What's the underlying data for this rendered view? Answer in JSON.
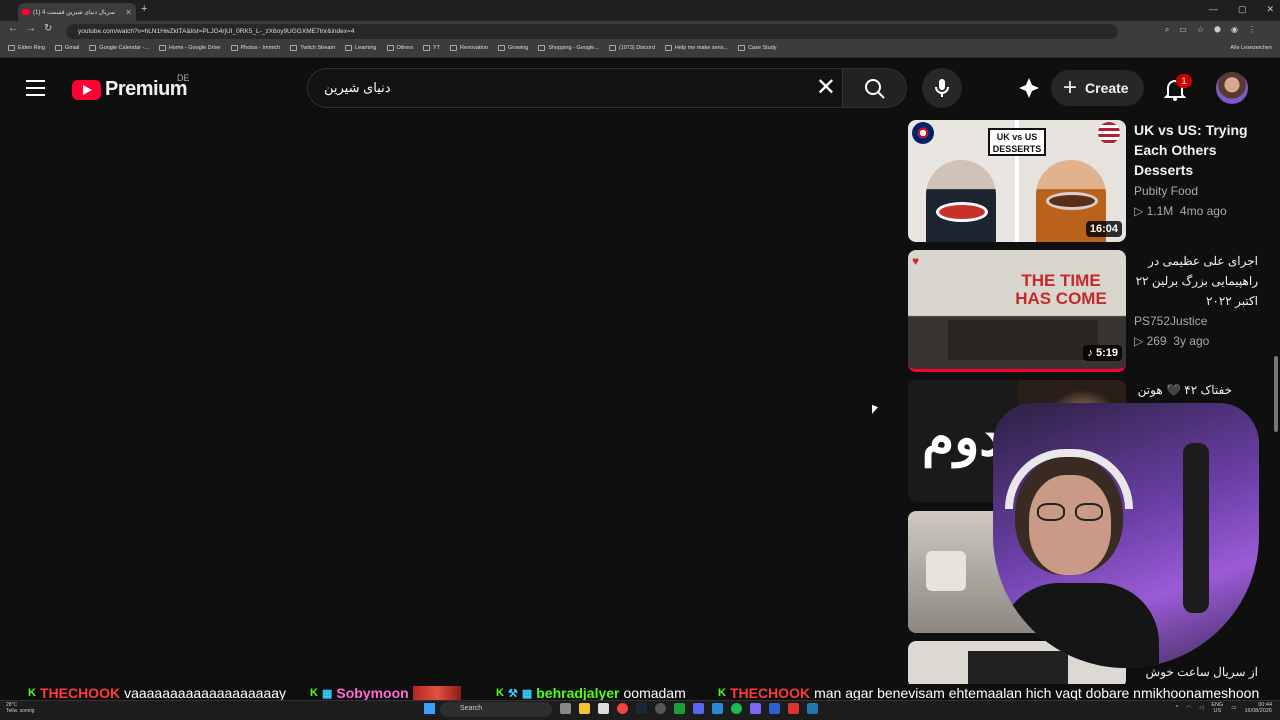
{
  "browser": {
    "tab_title": "(1) سریال دنیای شیرین قسمت 4",
    "url": "youtube.com/watch?v=hLN1HwZktTA&list=PLJG4rjUI_0RK5_L-_zX6oy9UGGXME7tnr&index=4",
    "bookmarks": [
      "Elden Ring",
      "Gmail",
      "Google Calendar -...",
      "Home - Google Drive",
      "Photos - Immich",
      "Twitch Stream",
      "Learning",
      "Others",
      "YT",
      "Renovation",
      "Growing",
      "Shopping - Google...",
      "(1073) Discord",
      "Help me make sens...",
      "Case Study"
    ],
    "all_bookmarks": "Alle Lesezeichen"
  },
  "header": {
    "logo_text": "Premium",
    "country": "DE",
    "search_value": "دنیای شیرین",
    "create_label": "Create",
    "notification_count": "1"
  },
  "recommendations": [
    {
      "title": "UK vs US: Trying Each Others Desserts",
      "channel": "Pubity Food",
      "views": "1.1M",
      "age": "4mo ago",
      "duration": "16:04",
      "thumb_text": "UK vs US DESSERTS"
    },
    {
      "title": "اجرای علی عظیمی در راهپیمایی بزرگ برلین ۲۲ اکتبر ۲۰۲۲",
      "channel": "PS752Justice",
      "views": "269",
      "age": "3y ago",
      "duration": "5:19",
      "thumb_text": "THE TIME HAS COME"
    },
    {
      "title": "خفتاک ۴۲ 🖤 هوتن",
      "channel": "",
      "views": "",
      "age": "",
      "duration": "",
      "thumb_text": "دوم"
    },
    {
      "title": "",
      "channel": "",
      "views": "",
      "age": "",
      "duration": ""
    },
    {
      "title": "از سریال ساعت خوش",
      "channel": "",
      "views": "",
      "age": "",
      "duration": ""
    }
  ],
  "chat": [
    {
      "user": "THECHOOK",
      "msg": "vaaaaaaaaaaaaaaaaaaay"
    },
    {
      "user": "Sobymoon",
      "msg": ""
    },
    {
      "user": "behradjalyer",
      "msg": "oomadam"
    },
    {
      "user": "THECHOOK",
      "msg": "man agar benevisam ehtemaalan hich vaqt dobare nmikhoonameshoon"
    }
  ],
  "taskbar": {
    "weather_temp": "28°C",
    "weather_desc": "Teilw. sonnig",
    "search_label": "Search",
    "lang": "ENG",
    "region": "US",
    "time": "00:44",
    "date": "16/08/2026"
  },
  "colors": {
    "accent": "#ff0033",
    "chat_name": "#ff3b3b",
    "kick_green": "#53fc18"
  }
}
